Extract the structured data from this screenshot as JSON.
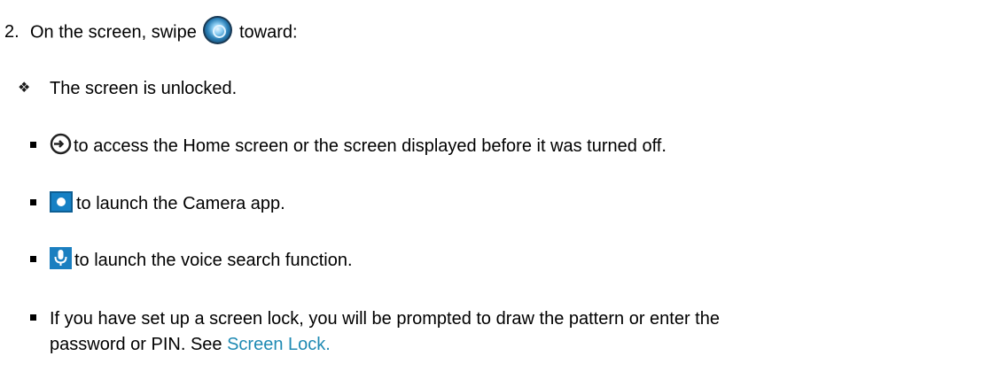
{
  "step": {
    "number": "2.",
    "text_before_icon": "On the screen, swipe",
    "text_after_icon": "toward:"
  },
  "subpoint": {
    "glyph": "❖",
    "text": "The screen is unlocked."
  },
  "bullets": [
    {
      "text": "to access the Home screen or the screen displayed before it was turned off."
    },
    {
      "text": "to launch the Camera app."
    },
    {
      "text": "to launch the voice search function."
    },
    {
      "text_line1": "If you have set up a screen lock, you will be prompted to draw the pattern or enter the",
      "text_line2_before_link": "password or PIN. See",
      "link_text": "Screen Lock."
    }
  ],
  "colors": {
    "link": "#1f8ab3",
    "icon_blue": "#1580c4"
  },
  "icons": [
    "lock-orb-icon",
    "unlock-icon",
    "camera-icon",
    "microphone-icon"
  ]
}
